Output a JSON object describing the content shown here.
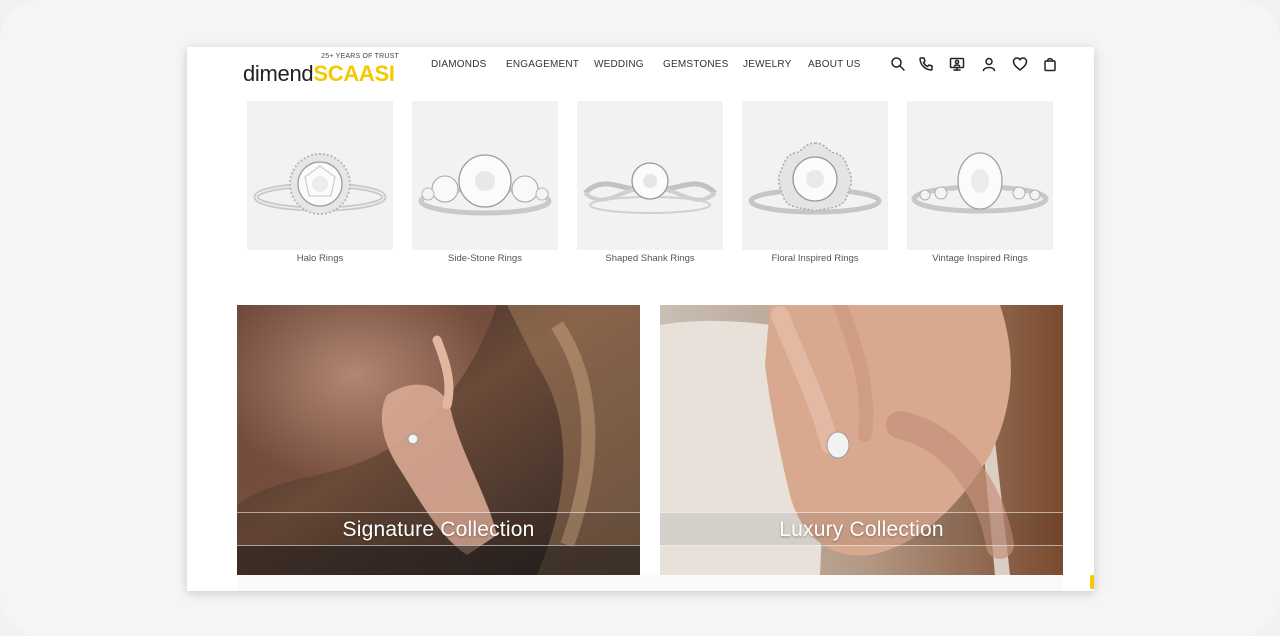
{
  "brand": {
    "name_part1": "dimend",
    "name_part2": "SCAASI",
    "tagline": "25+ YEARS OF TRUST",
    "accent_color": "#f5c900"
  },
  "nav": {
    "items": [
      {
        "label": "DIAMONDS"
      },
      {
        "label": "ENGAGEMENT"
      },
      {
        "label": "WEDDING"
      },
      {
        "label": "GEMSTONES"
      },
      {
        "label": "JEWELRY"
      },
      {
        "label": "ABOUT US"
      }
    ]
  },
  "header_icons": [
    "search-icon",
    "phone-icon",
    "virtual-appointment-icon",
    "account-icon",
    "wishlist-heart-icon",
    "shopping-bag-icon"
  ],
  "categories": [
    {
      "label": "Halo Rings",
      "icon": "halo-ring-image"
    },
    {
      "label": "Side-Stone Rings",
      "icon": "side-stone-ring-image"
    },
    {
      "label": "Shaped Shank Rings",
      "icon": "shaped-shank-ring-image"
    },
    {
      "label": "Floral Inspired Rings",
      "icon": "floral-ring-image"
    },
    {
      "label": "Vintage Inspired Rings",
      "icon": "vintage-ring-image"
    }
  ],
  "collections": [
    {
      "title": "Signature Collection"
    },
    {
      "title": "Luxury Collection"
    }
  ]
}
